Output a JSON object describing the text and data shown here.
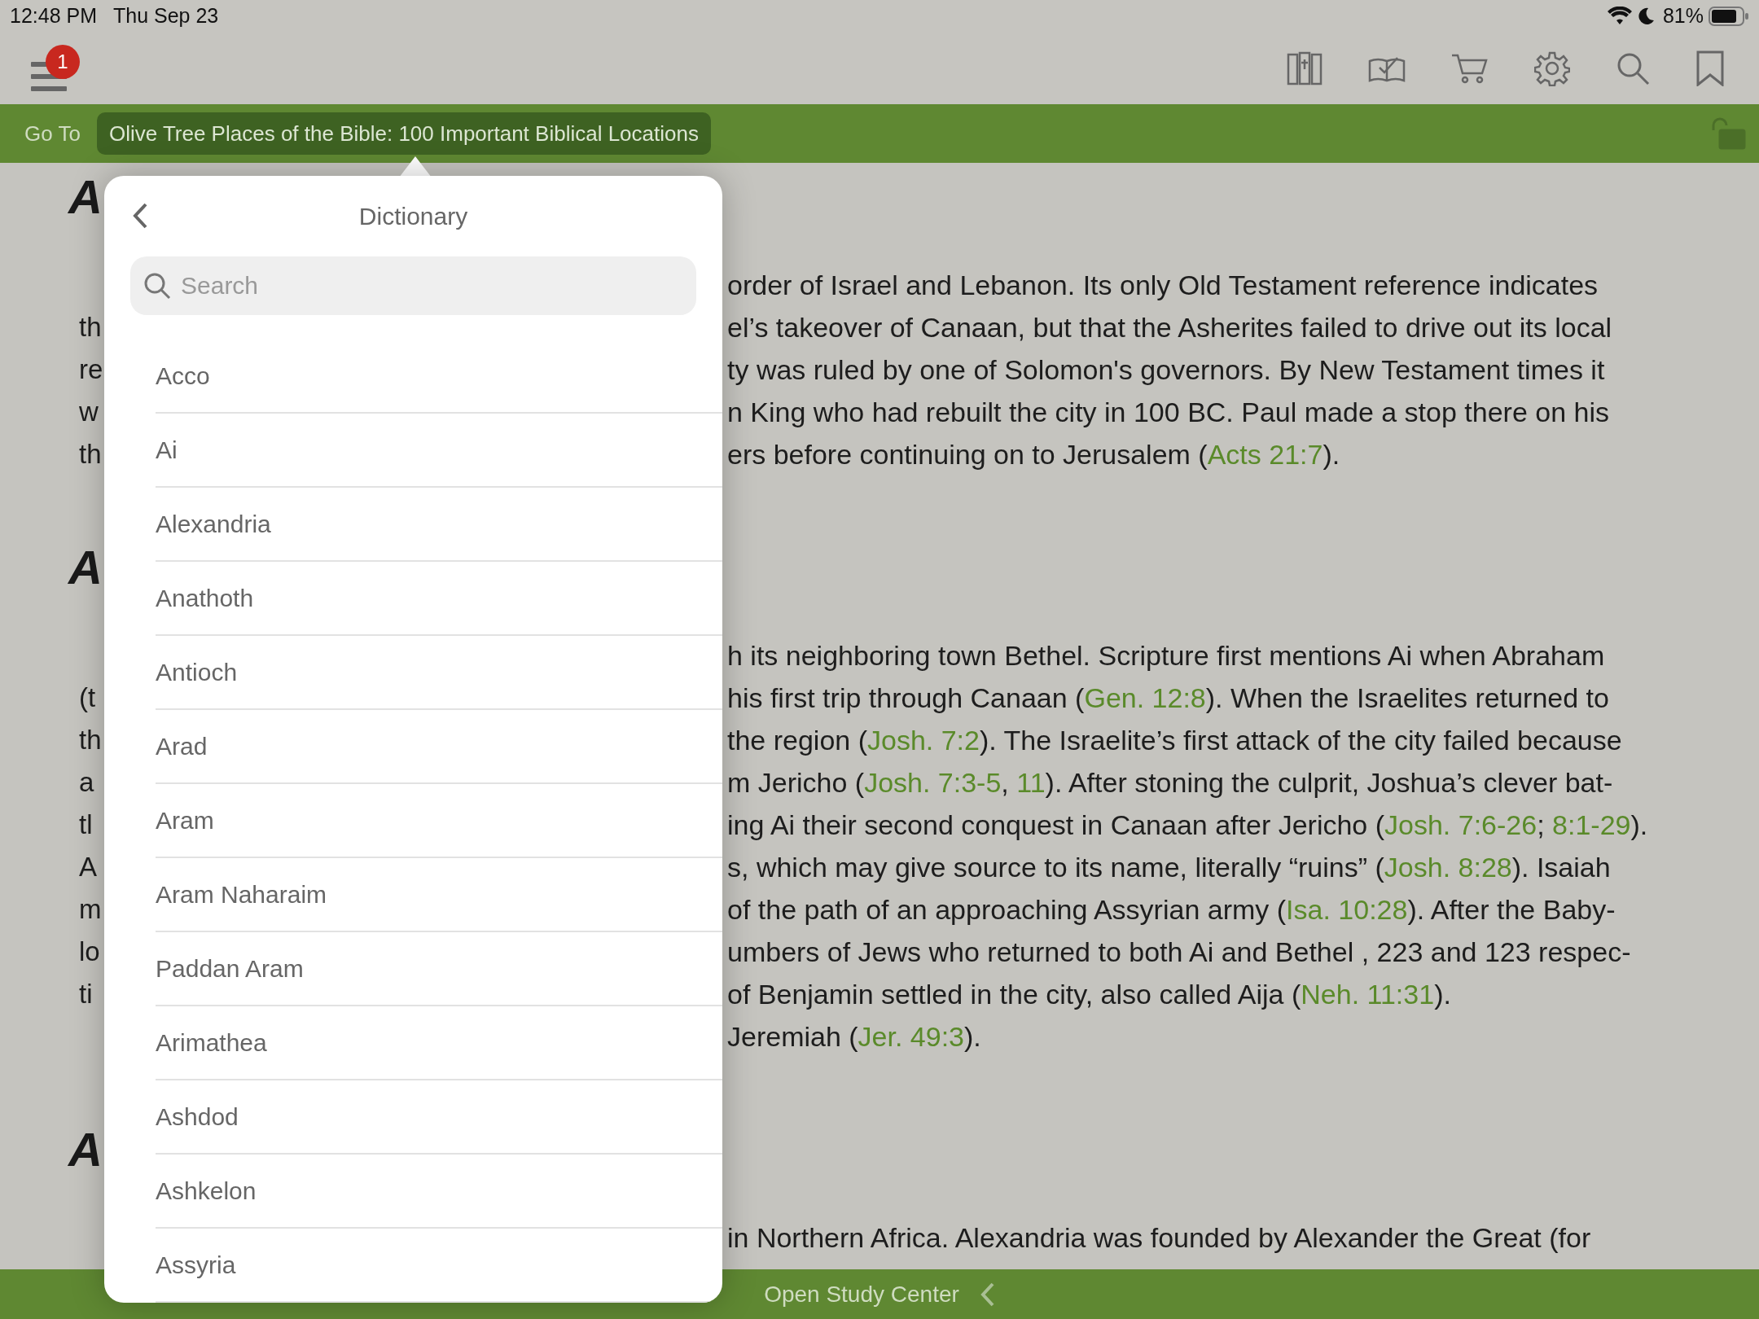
{
  "status_bar": {
    "time": "12:48 PM",
    "date": "Thu Sep 23",
    "battery": "81%"
  },
  "toolbar": {
    "menu_badge": "1"
  },
  "nav_bar": {
    "go_to": "Go To",
    "book_title": "Olive Tree Places of the Bible: 100 Important Biblical Locations"
  },
  "article": [
    {
      "kind": "heading",
      "left": "A"
    },
    {
      "kind": "line",
      "right": [
        "order of Israel and Lebanon. Its only Old Testament reference indicates"
      ]
    },
    {
      "kind": "line",
      "left": "th",
      "right": [
        "el’s takeover of Canaan, but that the Asherites failed to drive out its local"
      ]
    },
    {
      "kind": "line",
      "left": "re",
      "right": [
        "ty was ruled by one of Solomon's governors. By New Testament times it"
      ]
    },
    {
      "kind": "line",
      "left": "w",
      "right": [
        "n King who had rebuilt the city in 100 BC. Paul made a stop there on his"
      ]
    },
    {
      "kind": "line",
      "left": "th",
      "right": [
        "ers before continuing on to Jerusalem (",
        {
          "link": "Acts 21:7"
        },
        ")."
      ]
    },
    {
      "kind": "heading",
      "left": "A"
    },
    {
      "kind": "line",
      "right": [
        "h its neighboring town Bethel. Scripture first mentions Ai when Abraham"
      ]
    },
    {
      "kind": "line",
      "left": "(t",
      "right": [
        "his first trip through Canaan (",
        {
          "link": "Gen. 12:8"
        },
        "). When the Israelites returned to"
      ]
    },
    {
      "kind": "line",
      "left": "th",
      "right": [
        "the region (",
        {
          "link": "Josh. 7:2"
        },
        "). The Israelite’s first attack of the city failed because"
      ]
    },
    {
      "kind": "line",
      "left": "a",
      "right": [
        "m Jericho (",
        {
          "link": "Josh. 7:3-5"
        },
        ", ",
        {
          "link": "11"
        },
        "). After stoning the culprit, Joshua’s clever bat-"
      ]
    },
    {
      "kind": "line",
      "left": "tl",
      "right": [
        "ing Ai their second conquest in Canaan after Jericho (",
        {
          "link": "Josh. 7:6-26"
        },
        "; ",
        {
          "link": "8:1-29"
        },
        ")."
      ]
    },
    {
      "kind": "line",
      "left": "A",
      "right": [
        "s, which may give source to its name, literally “ruins” (",
        {
          "link": "Josh. 8:28"
        },
        "). Isaiah"
      ]
    },
    {
      "kind": "line",
      "left": "m",
      "right": [
        "of the path of an approaching Assyrian army (",
        {
          "link": "Isa. 10:28"
        },
        "). After the Baby-"
      ]
    },
    {
      "kind": "line",
      "left": "lo",
      "right": [
        "umbers of Jews who returned to both Ai and Bethel , 223 and 123 respec-"
      ]
    },
    {
      "kind": "line",
      "left": "ti",
      "right": [
        "of Benjamin settled in the city, also called Aija (",
        {
          "link": "Neh. 11:31"
        },
        ")."
      ]
    },
    {
      "kind": "line",
      "right": [
        "Jeremiah (",
        {
          "link": "Jer. 49:3"
        },
        ")."
      ]
    },
    {
      "kind": "heading",
      "left": "A"
    },
    {
      "kind": "line",
      "right": [
        "in Northern Africa. Alexandria was founded by Alexander the Great (for"
      ]
    }
  ],
  "popover": {
    "title": "Dictionary",
    "search": {
      "placeholder": "Search"
    },
    "entries": [
      "Acco",
      "Ai",
      "Alexandria",
      "Anathoth",
      "Antioch",
      "Arad",
      "Aram",
      "Aram Naharaim",
      "Paddan Aram",
      "Arimathea",
      "Ashdod",
      "Ashkelon",
      "Assyria"
    ]
  },
  "bottom_bar": {
    "label": "Open Study Center"
  }
}
